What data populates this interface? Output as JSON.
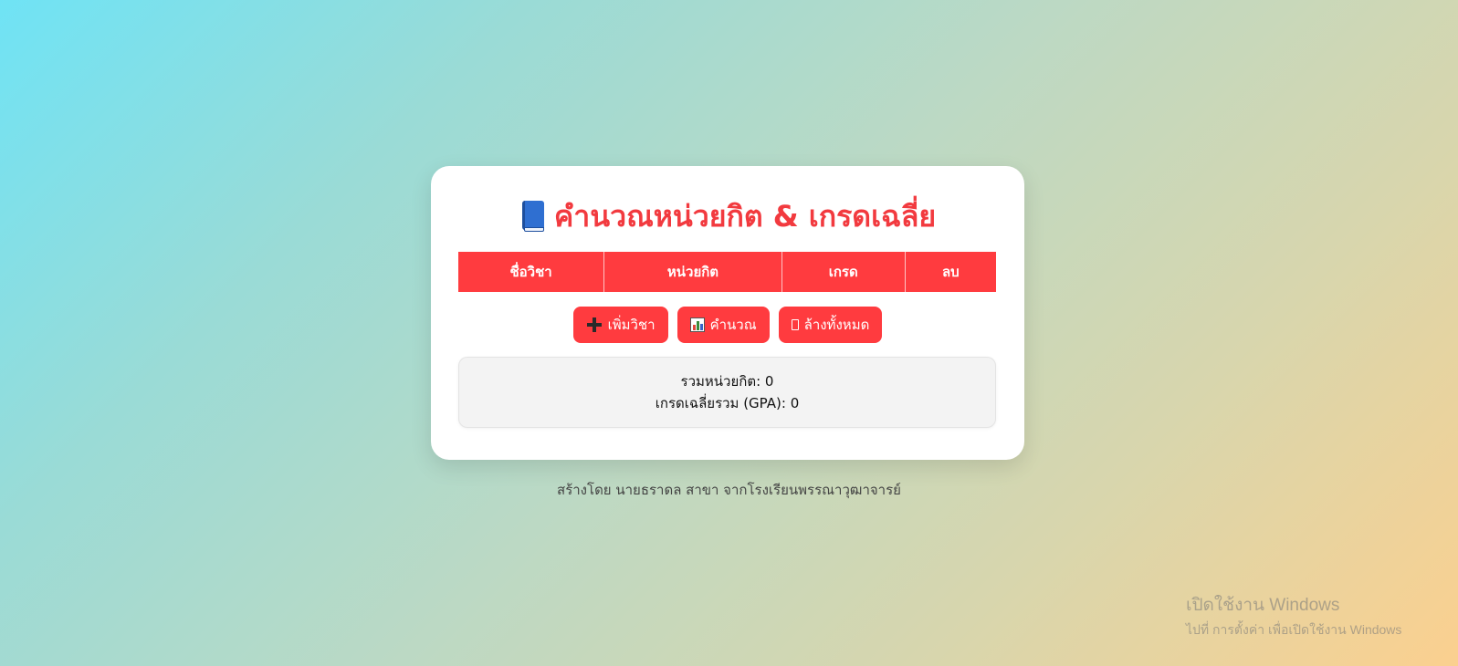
{
  "title": "คำนวณหน่วยกิต & เกรดเฉลี่ย",
  "title_icon": "blue-book-icon",
  "table": {
    "headers": [
      "ชื่อวิชา",
      "หน่วยกิต",
      "เกรด",
      "ลบ"
    ]
  },
  "buttons": {
    "add": {
      "label": "เพิ่มวิชา",
      "icon": "plus-icon"
    },
    "calculate": {
      "label": "คำนวณ",
      "icon": "bar-chart-icon"
    },
    "clear": {
      "label": "ล้างทั้งหมด",
      "icon": "trash-icon"
    }
  },
  "summary": {
    "total_credits": "รวมหน่วยกิต: 0",
    "gpa": "เกรดเฉลี่ยรวม (GPA): 0"
  },
  "footer": "สร้างโดย นายธราดล สาขา จากโรงเรียนพรรณาวุฒาจารย์",
  "windows_watermark": {
    "title": "เปิดใช้งาน Windows",
    "subtitle": "ไปที่ การตั้งค่า เพื่อเปิดใช้งาน Windows"
  },
  "colors": {
    "accent": "#ff3b3f",
    "title": "#f23a3f"
  }
}
